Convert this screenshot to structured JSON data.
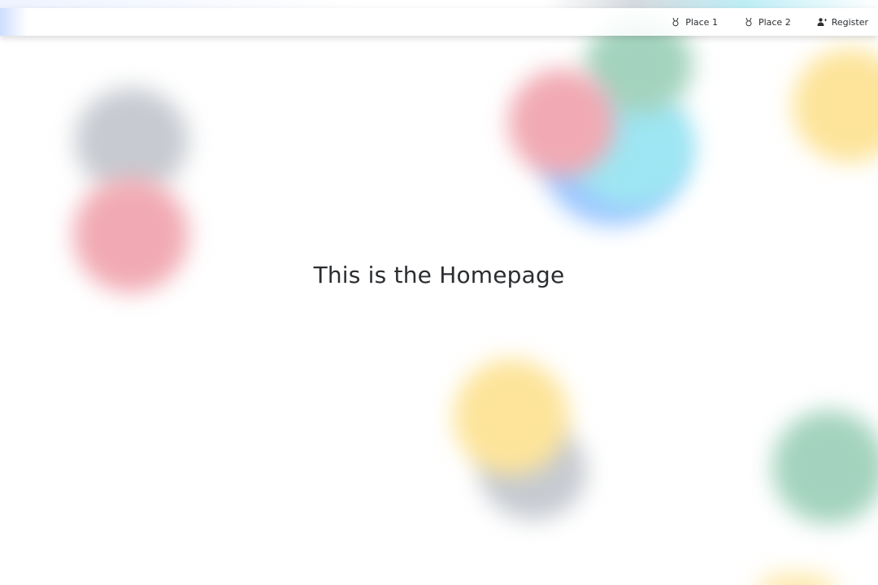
{
  "nav": {
    "items": [
      {
        "label": "Place 1",
        "icon": "medal-icon"
      },
      {
        "label": "Place 2",
        "icon": "medal-icon"
      },
      {
        "label": "Register",
        "icon": "user-plus-icon"
      }
    ]
  },
  "main": {
    "title": "This is the Homepage"
  },
  "colors": {
    "gray_blob": "#c7cbd1",
    "red_blob": "#f1aab3",
    "yellow_blob": "#fde49a",
    "green_blob": "#a3d3be",
    "cyan_blob": "#9ee6f3",
    "blue_blob": "#9ec8ff",
    "text": "#2a2d31"
  }
}
